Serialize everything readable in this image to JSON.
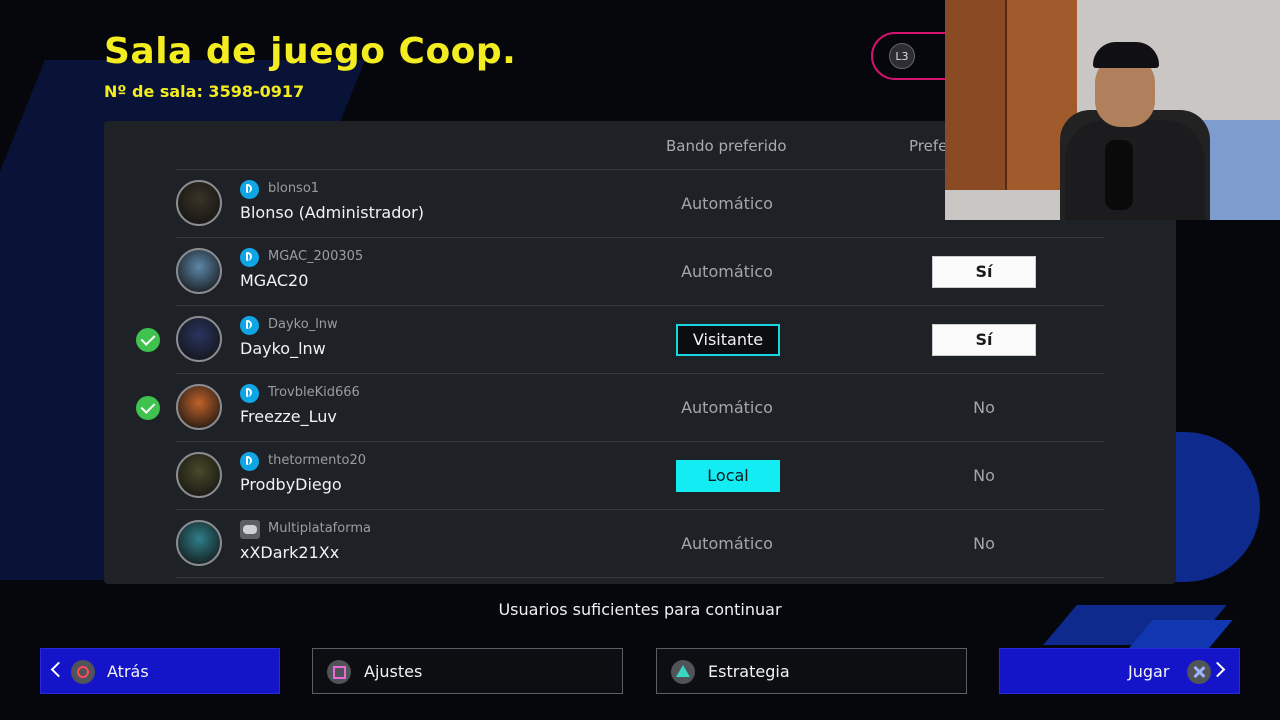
{
  "title": "Sala de juego Coop.",
  "room_number": "Nº de sala: 3598-0917",
  "l3_label": "L3",
  "columns": {
    "bando": "Bando preferido",
    "pref": "Prefe"
  },
  "players": [
    {
      "online_id": "blonso1",
      "name": "Blonso (Administrador)",
      "ready": false,
      "platform": "psn",
      "bando": "Automático",
      "bando_state": "text",
      "pref": "",
      "pref_state": "none",
      "avatar_color": "#3a3327"
    },
    {
      "online_id": "MGAC_200305",
      "name": "MGAC20",
      "ready": false,
      "platform": "psn",
      "bando": "Automático",
      "bando_state": "text",
      "pref": "Sí",
      "pref_state": "button",
      "avatar_color": "#5d87a8"
    },
    {
      "online_id": "Dayko_lnw",
      "name": "Dayko_lnw",
      "ready": true,
      "platform": "psn",
      "bando": "Visitante",
      "bando_state": "outlined",
      "pref": "Sí",
      "pref_state": "button",
      "avatar_color": "#2a3560"
    },
    {
      "online_id": "TrovbleKid666",
      "name": "Freezze_Luv",
      "ready": true,
      "platform": "psn",
      "bando": "Automático",
      "bando_state": "text",
      "pref": "No",
      "pref_state": "text",
      "avatar_color": "#c0622a"
    },
    {
      "online_id": "thetormento20",
      "name": "ProdbyDiego",
      "ready": false,
      "platform": "psn",
      "bando": "Local",
      "bando_state": "filled",
      "pref": "No",
      "pref_state": "text",
      "avatar_color": "#4a4a2a"
    },
    {
      "online_id": "Multiplataforma",
      "name": "xXDark21Xx",
      "ready": false,
      "platform": "cross",
      "bando": "Automático",
      "bando_state": "text",
      "pref": "No",
      "pref_state": "text",
      "avatar_color": "#2f7f8a"
    }
  ],
  "status_message": "Usuarios suficientes para continuar",
  "buttons": {
    "back": "Atrás",
    "settings": "Ajustes",
    "strategy": "Estrategia",
    "play": "Jugar"
  },
  "colors": {
    "title": "#f2ec21",
    "accent_cyan": "#14ecf4",
    "button_blue": "#1414c8",
    "ready_green": "#3fc24e",
    "l3_border": "#d3146c"
  },
  "icons": {
    "ready": "checkmark-icon",
    "psn": "playstation-icon",
    "cross_platform": "gamepad-icon",
    "back": "circle-button-icon",
    "settings": "square-button-icon",
    "strategy": "triangle-button-icon",
    "play": "cross-button-icon"
  }
}
